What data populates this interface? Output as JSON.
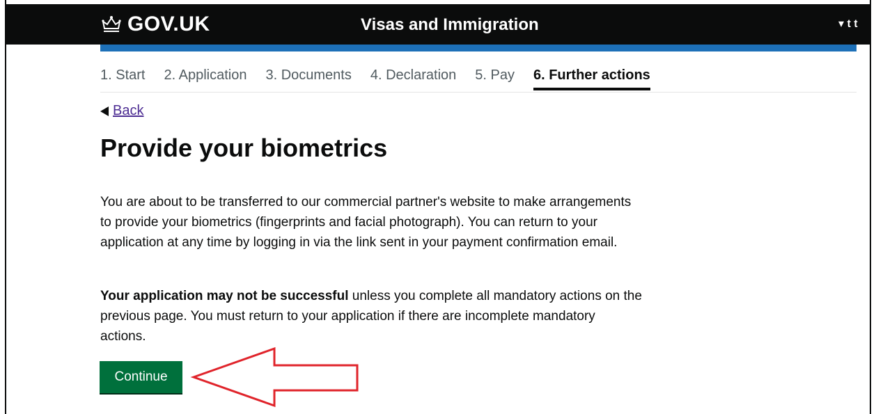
{
  "header": {
    "logo_text": "GOV.UK",
    "service_name": "Visas and Immigration",
    "corner_text": "▾ t t"
  },
  "steps": [
    {
      "label": "1. Start",
      "active": false
    },
    {
      "label": "2. Application",
      "active": false
    },
    {
      "label": "3. Documents",
      "active": false
    },
    {
      "label": "4. Declaration",
      "active": false
    },
    {
      "label": "5. Pay",
      "active": false
    },
    {
      "label": "6. Further actions",
      "active": true
    }
  ],
  "back_link": "Back",
  "page_title": "Provide your biometrics",
  "paragraph1": "You are about to be transferred to our commercial partner's website to make arrangements to provide your biometrics (fingerprints and facial photograph). You can return to your application at any time by logging in via the link sent in your payment confirmation email.",
  "paragraph2": {
    "bold": "Your application may not be successful",
    "rest": " unless you complete all mandatory actions on the previous page. You must return to your application if there are incomplete mandatory actions."
  },
  "continue_label": "Continue",
  "colors": {
    "header_bg": "#0b0c0c",
    "blue_bar": "#1d70b8",
    "button_green": "#00703c",
    "link_purple": "#4c2c92",
    "annotation_red": "#e0242b"
  },
  "icons": {
    "logo": "crown-icon",
    "back": "triangle-left-icon",
    "annotation": "red-arrow-outline"
  }
}
